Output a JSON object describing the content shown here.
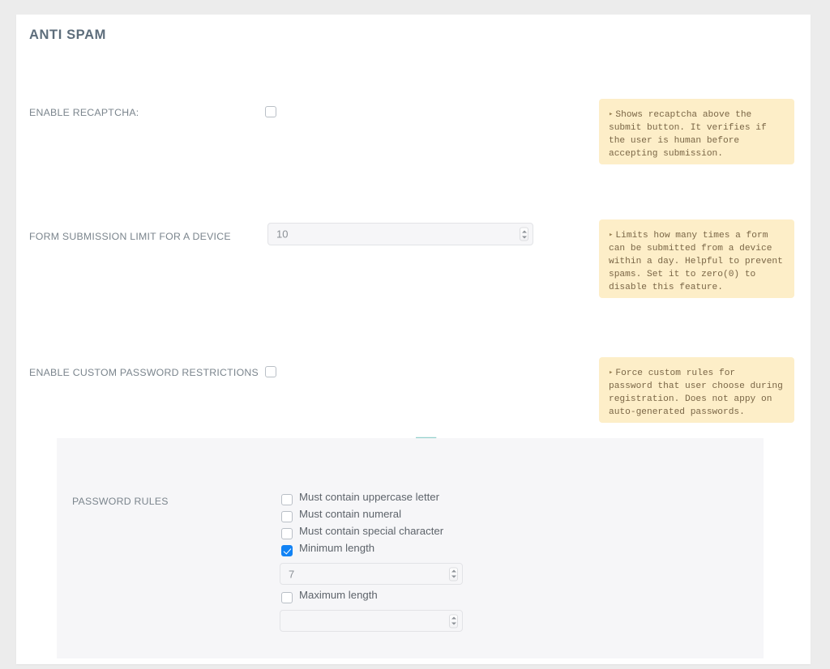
{
  "section": {
    "title": "ANTI SPAM"
  },
  "rows": [
    {
      "label": "ENABLE RECAPTCHA:",
      "control": "checkbox",
      "checked": false,
      "help": "Shows recaptcha above the submit button. It verifies if the user is human before accepting submission."
    },
    {
      "label": "FORM SUBMISSION LIMIT FOR A DEVICE",
      "control": "number",
      "value": "10",
      "help": "Limits how many times a form can be submitted from a device within a day. Helpful to prevent spams. Set it to zero(0) to disable this feature."
    },
    {
      "label": "ENABLE CUSTOM PASSWORD RESTRICTIONS",
      "control": "checkbox",
      "checked": false,
      "help": "Force custom rules for password that user choose during registration. Does not appy on auto-generated passwords."
    }
  ],
  "password_panel": {
    "label": "PASSWORD RULES",
    "rules": [
      {
        "label": "Must contain uppercase letter",
        "checked": false
      },
      {
        "label": "Must contain numeral",
        "checked": false
      },
      {
        "label": "Must contain special character",
        "checked": false
      },
      {
        "label": "Minimum length",
        "checked": true,
        "value": "7"
      },
      {
        "label": "Maximum length",
        "checked": false,
        "value": ""
      }
    ]
  },
  "icons": {
    "help_bullet": "▸",
    "connector": "elbow-down-arrow"
  },
  "colors": {
    "page_background": "#ececec",
    "card_background": "#ffffff",
    "title_text": "#5d6d7b",
    "label_text": "#7b858d",
    "help_background": "#fdeec8",
    "help_text": "#7a6646",
    "checkbox_checked": "#1283f5",
    "input_background": "#f6f6f8",
    "subpanel_background": "#f6f6f8",
    "connector_arrow": "#8fcfcb"
  }
}
